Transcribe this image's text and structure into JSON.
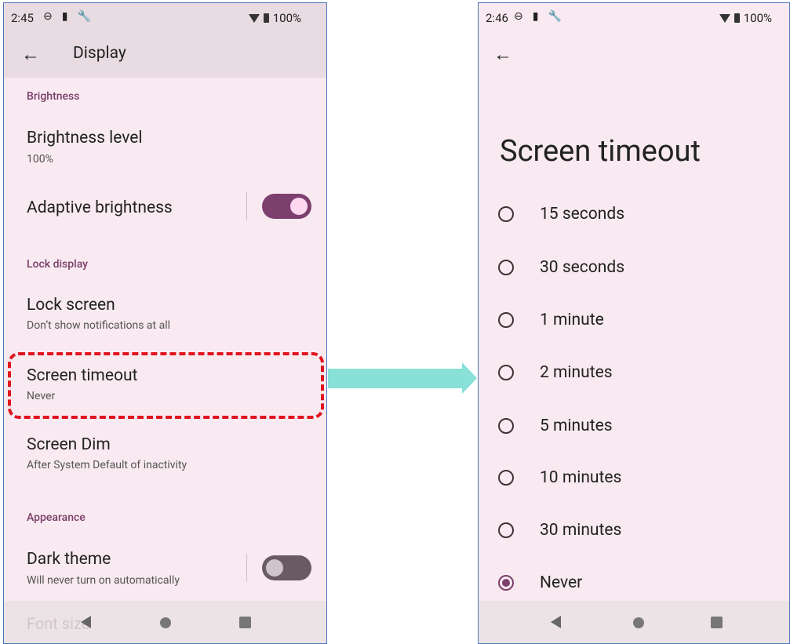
{
  "left_screen": {
    "status": {
      "time": "2:45",
      "battery": "100%"
    },
    "title": "Display",
    "sections": {
      "brightness": "Brightness",
      "lock_display": "Lock display",
      "appearance": "Appearance"
    },
    "items": {
      "brightness_level": {
        "title": "Brightness level",
        "subtitle": "100%"
      },
      "adaptive_brightness": {
        "title": "Adaptive brightness",
        "toggle": "on"
      },
      "lock_screen": {
        "title": "Lock screen",
        "subtitle": "Don’t show notifications at all"
      },
      "screen_timeout": {
        "title": "Screen timeout",
        "subtitle": "Never"
      },
      "screen_dim": {
        "title": "Screen Dim",
        "subtitle": "After System Default of inactivity"
      },
      "dark_theme": {
        "title": "Dark theme",
        "subtitle": "Will never turn on automatically",
        "toggle": "off"
      },
      "font_size": {
        "title": "Font size"
      }
    }
  },
  "right_screen": {
    "status": {
      "time": "2:46",
      "battery": "100%"
    },
    "title": "Screen timeout",
    "options": [
      {
        "label": "15 seconds",
        "selected": false
      },
      {
        "label": "30 seconds",
        "selected": false
      },
      {
        "label": "1 minute",
        "selected": false
      },
      {
        "label": "2 minutes",
        "selected": false
      },
      {
        "label": "5 minutes",
        "selected": false
      },
      {
        "label": "10 minutes",
        "selected": false
      },
      {
        "label": "30 minutes",
        "selected": false
      },
      {
        "label": "Never",
        "selected": true
      }
    ]
  },
  "colors": {
    "accent": "#7d3f6e",
    "highlight": "#e0141e",
    "arrow": "#88e0d6",
    "background": "#f8eaf0"
  }
}
